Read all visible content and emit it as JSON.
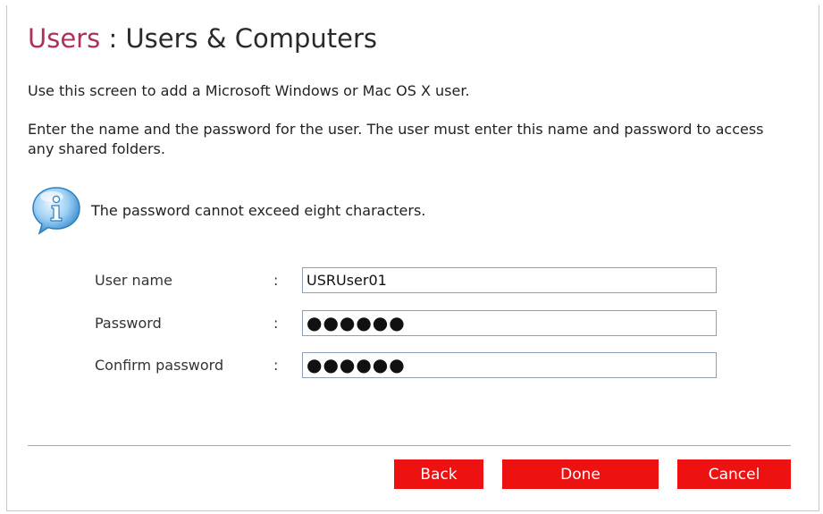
{
  "header": {
    "section": "Users",
    "separator": ":",
    "title": "Users & Computers"
  },
  "intro": {
    "line1": "Use this screen to add a Microsoft Windows or Mac OS X user.",
    "line2": "Enter the name and the password for the user. The user must enter this name and password to access any shared folders."
  },
  "info": {
    "icon": "info-icon",
    "text": "The password cannot exceed eight characters."
  },
  "form": {
    "separator": ":",
    "username": {
      "label": "User name",
      "value": "USRUser01"
    },
    "password": {
      "label": "Password",
      "value": "●●●●●●"
    },
    "confirm": {
      "label": "Confirm password",
      "value": "●●●●●●"
    }
  },
  "buttons": {
    "back": "Back",
    "done": "Done",
    "cancel": "Cancel"
  },
  "colors": {
    "accent": "#b0305a",
    "button": "#ee1111",
    "field_border": "#8ea0b8"
  }
}
